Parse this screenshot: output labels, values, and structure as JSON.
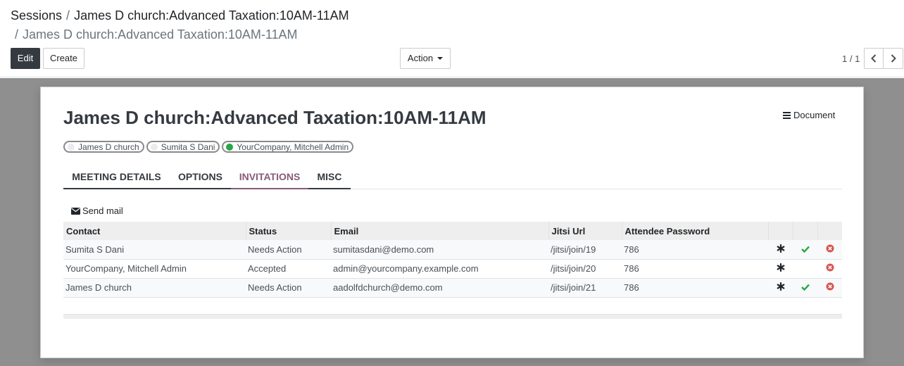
{
  "breadcrumb": {
    "root": "Sessions",
    "separator": "/",
    "parent": "James D church:Advanced Taxation:10AM-11AM",
    "current": "James D church:Advanced Taxation:10AM-11AM"
  },
  "toolbar": {
    "edit_label": "Edit",
    "create_label": "Create",
    "action_label": "Action"
  },
  "pager": {
    "value": "1 / 1"
  },
  "record": {
    "title": "James D church:Advanced Taxation:10AM-11AM",
    "document_label": "Document",
    "attendee_tags": [
      {
        "label": "James D church",
        "status": "grey"
      },
      {
        "label": "Sumita S Dani",
        "status": "grey"
      },
      {
        "label": "YourCompany, Mitchell Admin",
        "status": "green"
      }
    ]
  },
  "tabs": [
    {
      "label": "MEETING DETAILS"
    },
    {
      "label": "OPTIONS"
    },
    {
      "label": "INVITATIONS"
    },
    {
      "label": "MISC"
    }
  ],
  "active_tab": "INVITATIONS",
  "invitations": {
    "send_mail_label": "Send mail",
    "columns": [
      "Contact",
      "Status",
      "Email",
      "Jitsi Url",
      "Attendee Password"
    ],
    "rows": [
      {
        "contact": "Sumita S Dani",
        "status": "Needs Action",
        "email": "sumitasdani@demo.com",
        "jitsi": "/jitsi/join/19",
        "password": "786",
        "accept": true
      },
      {
        "contact": "YourCompany, Mitchell Admin",
        "status": "Accepted",
        "email": "admin@yourcompany.example.com",
        "jitsi": "/jitsi/join/20",
        "password": "786",
        "accept": false
      },
      {
        "contact": "James D church",
        "status": "Needs Action",
        "email": "aadolfdchurch@demo.com",
        "jitsi": "/jitsi/join/21",
        "password": "786",
        "accept": true
      }
    ]
  },
  "colors": {
    "accent": "#875a7b",
    "check": "#28a745",
    "decline": "#d9534f",
    "form_bg": "#8f8f8f"
  }
}
